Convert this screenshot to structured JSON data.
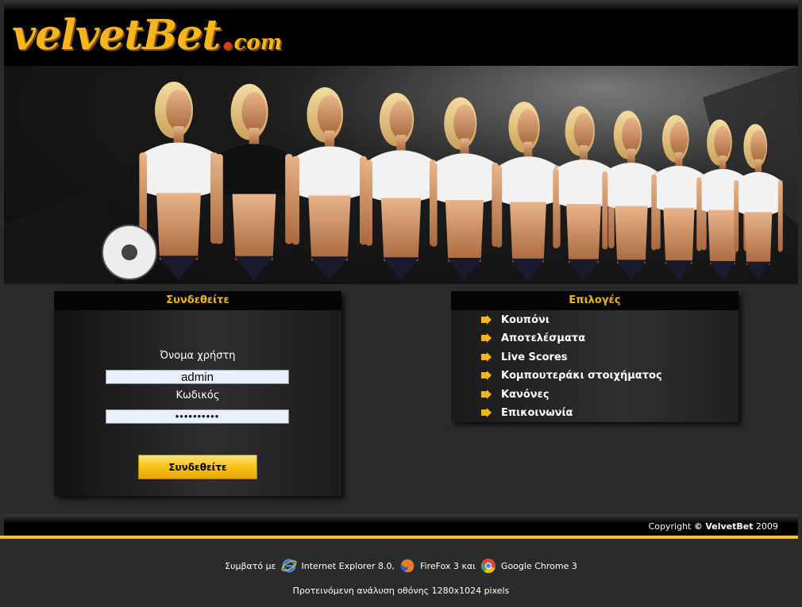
{
  "header": {
    "logo_main": "velvetBet",
    "logo_dot": ".",
    "logo_tld": "com"
  },
  "login": {
    "title": "Συνδεθείτε",
    "username_label": "Όνομα χρήστη",
    "username_value": "admin",
    "password_label": "Κωδικός",
    "password_value": "••••••••••",
    "button_label": "Συνδεθείτε"
  },
  "options": {
    "title": "Επιλογές",
    "items": [
      {
        "label": "Κουπόνι"
      },
      {
        "label": "Αποτελέσματα"
      },
      {
        "label": "Live Scores"
      },
      {
        "label": "Κομπουτεράκι στοιχήματος"
      },
      {
        "label": "Κανόνες"
      },
      {
        "label": "Επικοινωνία"
      }
    ]
  },
  "footer": {
    "copyright_prefix": "Copyright",
    "copyright_symbol": "©",
    "brand": "VelvetBet",
    "year": "2009"
  },
  "compat": {
    "prefix": "Συμβατό με",
    "ie": "Internet Explorer 8.0,",
    "firefox": "FireFox 3 και",
    "chrome": "Google Chrome 3",
    "resolution": "Προτεινόμενη ανάλυση οθόνης 1280x1024 pixels"
  },
  "colors": {
    "accent": "#f3b51b",
    "background": "#2b2b2b",
    "header": "#000000"
  },
  "icons": {
    "menu_bullet": "arrow-right-icon",
    "ie": "internet-explorer-icon",
    "firefox": "firefox-icon",
    "chrome": "chrome-icon"
  }
}
